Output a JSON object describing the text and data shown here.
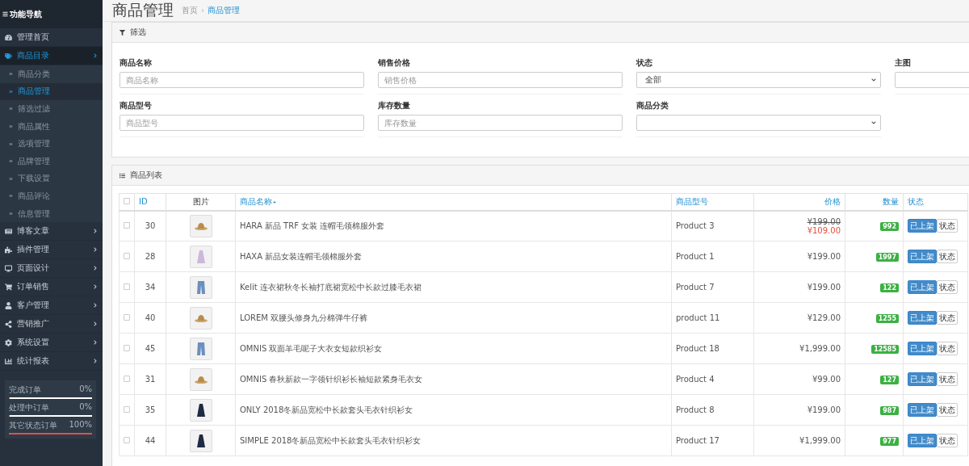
{
  "sidebar": {
    "title": "功能导航",
    "items": [
      {
        "label": "管理首页",
        "expanded": false,
        "has_arrow": false
      },
      {
        "label": "商品目录",
        "expanded": true,
        "has_arrow": true,
        "children": [
          {
            "label": "商品分类",
            "selected": false
          },
          {
            "label": "商品管理",
            "selected": true
          },
          {
            "label": "筛选过滤",
            "selected": false
          },
          {
            "label": "商品属性",
            "selected": false
          },
          {
            "label": "选项管理",
            "selected": false
          },
          {
            "label": "品牌管理",
            "selected": false
          },
          {
            "label": "下载设置",
            "selected": false
          },
          {
            "label": "商品评论",
            "selected": false
          },
          {
            "label": "信息管理",
            "selected": false
          }
        ]
      },
      {
        "label": "博客文章",
        "expanded": false,
        "has_arrow": true
      },
      {
        "label": "插件管理",
        "expanded": false,
        "has_arrow": true
      },
      {
        "label": "页面设计",
        "expanded": false,
        "has_arrow": true
      },
      {
        "label": "订单销售",
        "expanded": false,
        "has_arrow": true
      },
      {
        "label": "客户管理",
        "expanded": false,
        "has_arrow": true
      },
      {
        "label": "营销推广",
        "expanded": false,
        "has_arrow": true
      },
      {
        "label": "系统设置",
        "expanded": false,
        "has_arrow": true
      },
      {
        "label": "统计报表",
        "expanded": false,
        "has_arrow": true
      }
    ],
    "stats": [
      {
        "label": "完成订单",
        "reading": "0%",
        "level": 0
      },
      {
        "label": "处理中订单",
        "reading": "0%",
        "level": 0
      },
      {
        "label": "其它状态订单",
        "reading": "100%",
        "level": 1,
        "color": "#d9534f"
      }
    ]
  },
  "page": {
    "title": "商品管理",
    "breadcrumb": [
      {
        "label": "首页",
        "current": false
      },
      {
        "label": "商品管理",
        "current": true
      }
    ]
  },
  "filter": {
    "title": "筛选",
    "fields": [
      {
        "label": "商品名称",
        "kind": "input",
        "placeholder": "商品名称"
      },
      {
        "label": "销售价格",
        "kind": "input",
        "placeholder": "销售价格"
      },
      {
        "label": "状态",
        "kind": "select",
        "value": "全部"
      },
      {
        "label": "主图",
        "kind": "input"
      },
      {
        "label": "商品型号",
        "kind": "input",
        "placeholder": "商品型号"
      },
      {
        "label": "库存数量",
        "kind": "input",
        "placeholder": "库存数量"
      },
      {
        "label": "商品分类",
        "kind": "select"
      }
    ]
  },
  "table": {
    "title": "商品列表",
    "select_all_checked": false,
    "columns": [
      {
        "label": "ID",
        "sortable": true,
        "sorted": false
      },
      {
        "label": "图片",
        "sortable": false,
        "sorted": false
      },
      {
        "label": "商品名称",
        "sortable": true,
        "sorted": true
      },
      {
        "label": "商品型号",
        "sortable": true,
        "sorted": false
      },
      {
        "label": "价格",
        "sortable": true,
        "sorted": false
      },
      {
        "label": "数量",
        "sortable": true,
        "sorted": false
      },
      {
        "label": "状态",
        "sortable": true,
        "sorted": false
      }
    ],
    "rows": [
      {
        "checked": false,
        "id": "30",
        "name": "HARA 新品 TRF 女装 连帽毛领棉服外套",
        "model": "Product 3",
        "old_price": "¥199.00",
        "price": "¥109.00",
        "special": true,
        "quantity": "992",
        "status": [
          {
            "label": "已上架",
            "selected": true
          },
          {
            "label": "状态",
            "selected": false
          }
        ]
      },
      {
        "checked": false,
        "id": "28",
        "name": "HAXA 新品女装连帽毛领棉服外套",
        "model": "Product 1",
        "price": "¥199.00",
        "special": false,
        "quantity": "1997",
        "status": [
          {
            "label": "已上架",
            "selected": true
          },
          {
            "label": "状态",
            "selected": false
          }
        ]
      },
      {
        "checked": false,
        "id": "34",
        "name": "Kelit 连衣裙秋冬长袖打底裙宽松中长款过膝毛衣裙",
        "model": "Product 7",
        "price": "¥199.00",
        "special": false,
        "quantity": "122",
        "status": [
          {
            "label": "已上架",
            "selected": true
          },
          {
            "label": "状态",
            "selected": false
          }
        ]
      },
      {
        "checked": false,
        "id": "40",
        "name": "LOREM 双腰头修身九分棉弹牛仔裤",
        "model": "product 11",
        "price": "¥129.00",
        "special": false,
        "quantity": "1255",
        "status": [
          {
            "label": "已上架",
            "selected": true
          },
          {
            "label": "状态",
            "selected": false
          }
        ]
      },
      {
        "checked": false,
        "id": "45",
        "name": "OMNIS 双面羊毛呢子大衣女短款织衫女",
        "model": "Product 18",
        "price": "¥1,999.00",
        "special": false,
        "quantity": "12585",
        "status": [
          {
            "label": "已上架",
            "selected": true
          },
          {
            "label": "状态",
            "selected": false
          }
        ]
      },
      {
        "checked": false,
        "id": "31",
        "name": "OMNIS 春秋新款一字领针织衫长袖短款紧身毛衣女",
        "model": "Product 4",
        "price": "¥99.00",
        "special": false,
        "quantity": "127",
        "status": [
          {
            "label": "已上架",
            "selected": true
          },
          {
            "label": "状态",
            "selected": false
          }
        ]
      },
      {
        "checked": false,
        "id": "35",
        "name": "ONLY 2018冬新品宽松中长款套头毛衣针织衫女",
        "model": "Product 8",
        "price": "¥199.00",
        "special": false,
        "quantity": "987",
        "status": [
          {
            "label": "已上架",
            "selected": true
          },
          {
            "label": "状态",
            "selected": false
          }
        ]
      },
      {
        "checked": false,
        "id": "44",
        "name": "SIMPLE 2018冬新品宽松中长款套头毛衣针织衫女",
        "model": "Product 17",
        "price": "¥1,999.00",
        "special": false,
        "quantity": "977",
        "status": [
          {
            "label": "已上架",
            "selected": true
          },
          {
            "label": "状态",
            "selected": false
          }
        ]
      }
    ]
  }
}
